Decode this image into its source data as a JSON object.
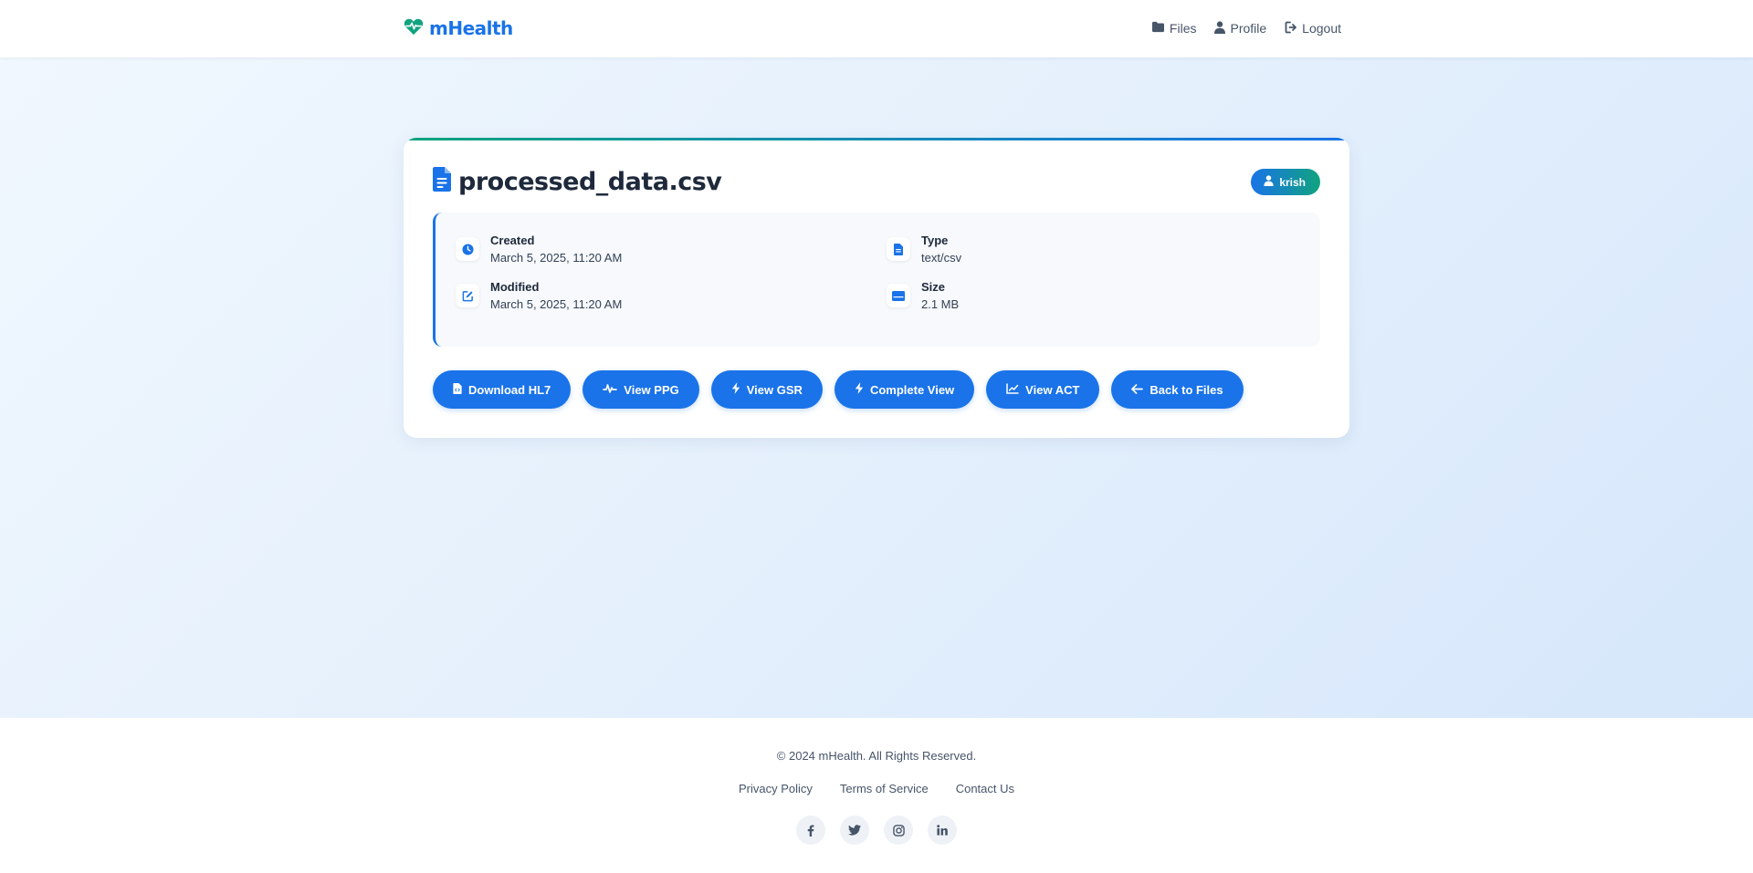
{
  "nav": {
    "brand": "mHealth",
    "links": [
      {
        "label": "Files",
        "icon": "folder-icon"
      },
      {
        "label": "Profile",
        "icon": "user-icon"
      },
      {
        "label": "Logout",
        "icon": "logout-icon"
      }
    ]
  },
  "file": {
    "name": "processed_data.csv",
    "owner": "krish",
    "created_label": "Created",
    "created_value": "March 5, 2025, 11:20 AM",
    "modified_label": "Modified",
    "modified_value": "March 5, 2025, 11:20 AM",
    "type_label": "Type",
    "type_value": "text/csv",
    "size_label": "Size",
    "size_value": "2.1 MB"
  },
  "actions": [
    {
      "label": "Download HL7",
      "icon": "file-code-icon"
    },
    {
      "label": "View PPG",
      "icon": "waveform-icon"
    },
    {
      "label": "View GSR",
      "icon": "bolt-icon"
    },
    {
      "label": "Complete View",
      "icon": "bolt-icon"
    },
    {
      "label": "View ACT",
      "icon": "line-chart-icon"
    },
    {
      "label": "Back to Files",
      "icon": "arrow-left-icon"
    }
  ],
  "footer": {
    "copyright": "© 2024 mHealth. All Rights Reserved.",
    "links": [
      "Privacy Policy",
      "Terms of Service",
      "Contact Us"
    ],
    "socials": [
      "facebook-icon",
      "twitter-icon",
      "instagram-icon",
      "linkedin-icon"
    ]
  },
  "colors": {
    "primary": "#1a73e8",
    "accent": "#10a37f"
  }
}
